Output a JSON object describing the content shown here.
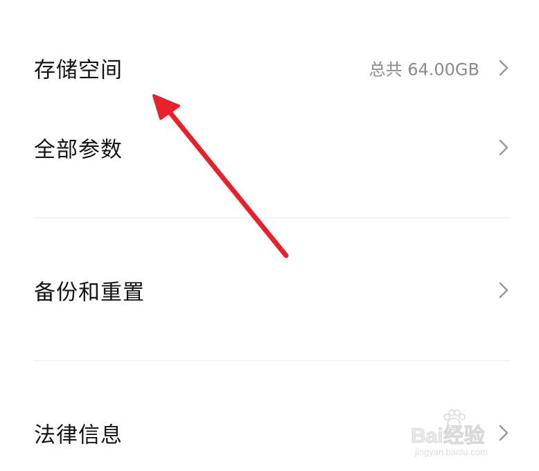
{
  "settings": {
    "items": [
      {
        "label": "存储空间",
        "value": "总共 64.00GB"
      },
      {
        "label": "全部参数",
        "value": ""
      },
      {
        "label": "备份和重置",
        "value": ""
      },
      {
        "label": "法律信息",
        "value": ""
      }
    ]
  },
  "annotation": {
    "arrow_color": "#e8202a",
    "arrow_target": "存储空间"
  },
  "watermark": {
    "text": "Bai经验",
    "url": "jingyan.baidu.com"
  },
  "icons": {
    "chevron": "chevron-right-icon"
  }
}
